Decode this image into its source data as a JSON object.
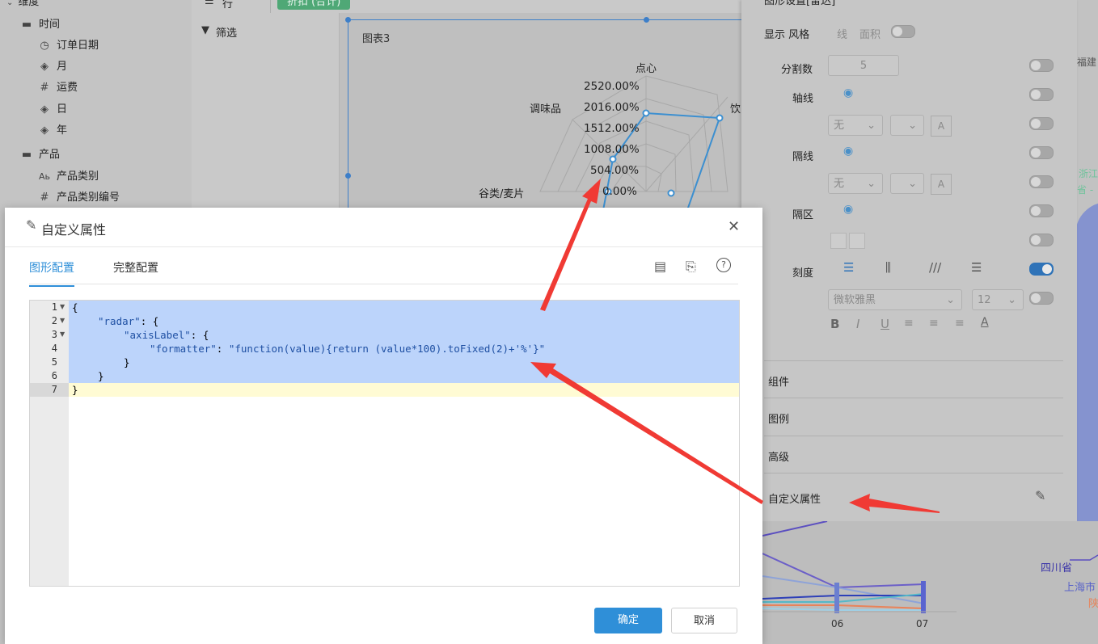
{
  "left_panel": {
    "dimension_title": "维度",
    "groups": [
      {
        "label": "时间",
        "icon": "folder-icon"
      },
      {
        "label": "产品",
        "icon": "folder-icon"
      }
    ],
    "time_fields": [
      {
        "label": "订单日期",
        "icon": "calendar-icon"
      },
      {
        "label": "月",
        "icon": "layers-icon"
      },
      {
        "label": "运费",
        "icon": "hash-icon"
      },
      {
        "label": "日",
        "icon": "layers-icon"
      },
      {
        "label": "年",
        "icon": "layers-icon"
      }
    ],
    "product_fields": [
      {
        "label": "产品类别",
        "icon": "text-field-icon"
      },
      {
        "label": "产品类别编号",
        "icon": "hash-icon"
      }
    ]
  },
  "toolbar": {
    "row_label": "行",
    "pill_label": "折扣 (合计)",
    "filter_label": "筛选"
  },
  "chart": {
    "title": "图表3",
    "axes": [
      "点心",
      "饮",
      "谷类/麦片",
      "调味品"
    ],
    "ticks": [
      "2520.00%",
      "2016.00%",
      "1512.00%",
      "1008.00%",
      "504.00%",
      "0.00%"
    ]
  },
  "right_panel": {
    "header": "图形设置[雷达]",
    "display_style_label": "显示 风格",
    "line_option": "线",
    "area_option": "面积",
    "split_count_label": "分割数",
    "split_count_value": "5",
    "axis_line_label": "轴线",
    "split_line_label": "隔线",
    "split_area_label": "隔区",
    "scale_label": "刻度",
    "none_option_1": "无",
    "none_option_2": "无",
    "font_value": "微软雅黑",
    "font_size_value": "12",
    "format_buttons": [
      "B",
      "I",
      "U"
    ],
    "sections": [
      "组件",
      "图例",
      "高级"
    ],
    "custom_attr_label": "自定义属性"
  },
  "far_right": {
    "labels": [
      "福建",
      "浙江",
      "省 -"
    ]
  },
  "bottom_chart": {
    "legend": [
      "四川省",
      "上海市",
      "陕"
    ],
    "x_ticks": [
      "06",
      "07"
    ]
  },
  "modal": {
    "title": "自定义属性",
    "tabs": [
      "图形配置",
      "完整配置"
    ],
    "active_tab": "图形配置",
    "line_numbers": [
      "1",
      "2",
      "3",
      "4",
      "5",
      "6",
      "7"
    ],
    "code": {
      "l1": "{",
      "l2_key": "\"radar\"",
      "l2_rest": ": {",
      "l3_key": "\"axisLabel\"",
      "l3_rest": ": {",
      "l4_key": "\"formatter\"",
      "l4_mid": ": ",
      "l4_val": "\"function(value){return (value*100).toFixed(2)+'%'}\"",
      "l5": "}",
      "l6": "}",
      "l7": "}"
    },
    "confirm_label": "确定",
    "cancel_label": "取消"
  },
  "colors": {
    "accent": "#2f8fd8",
    "confirm_bg": "#2f8fd8",
    "selection": "#bcd4fb",
    "active_line": "#fffbd4",
    "arrow": "#f03a34",
    "radar_line": "#3c8fd0"
  }
}
